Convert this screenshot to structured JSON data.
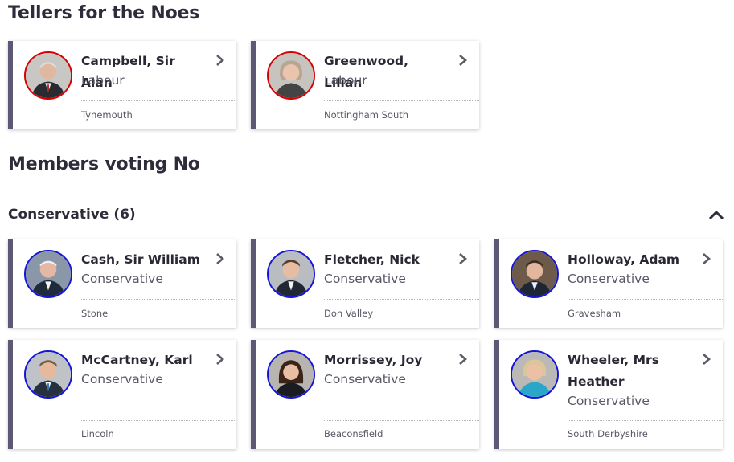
{
  "tellers": {
    "heading": "Tellers for the Noes",
    "cards": [
      {
        "name": "Campbell, Sir Alan",
        "party": "Labour",
        "constituency": "Tynemouth"
      },
      {
        "name": "Greenwood, Lilian",
        "party": "Labour",
        "constituency": "Nottingham South"
      }
    ]
  },
  "members": {
    "heading": "Members voting No",
    "group": {
      "title": "Conservative (6)",
      "cards": [
        {
          "name": "Cash, Sir William",
          "party": "Conservative",
          "constituency": "Stone"
        },
        {
          "name": "Fletcher, Nick",
          "party": "Conservative",
          "constituency": "Don Valley"
        },
        {
          "name": "Holloway, Adam",
          "party": "Conservative",
          "constituency": "Gravesham"
        },
        {
          "name": "McCartney, Karl",
          "party": "Conservative",
          "constituency": "Lincoln"
        },
        {
          "name": "Morrissey, Joy",
          "party": "Conservative",
          "constituency": "Beaconsfield"
        },
        {
          "name": "Wheeler, Mrs Heather",
          "party": "Conservative",
          "constituency": "South Derbyshire"
        }
      ]
    }
  },
  "colors": {
    "labour": "#d50000",
    "conservative": "#1515d6",
    "card_accent": "#5f5875",
    "heading": "#2f2b3a"
  },
  "icons": {
    "card_arrow": "chevron-right-icon",
    "group_toggle": "chevron-up-icon"
  }
}
